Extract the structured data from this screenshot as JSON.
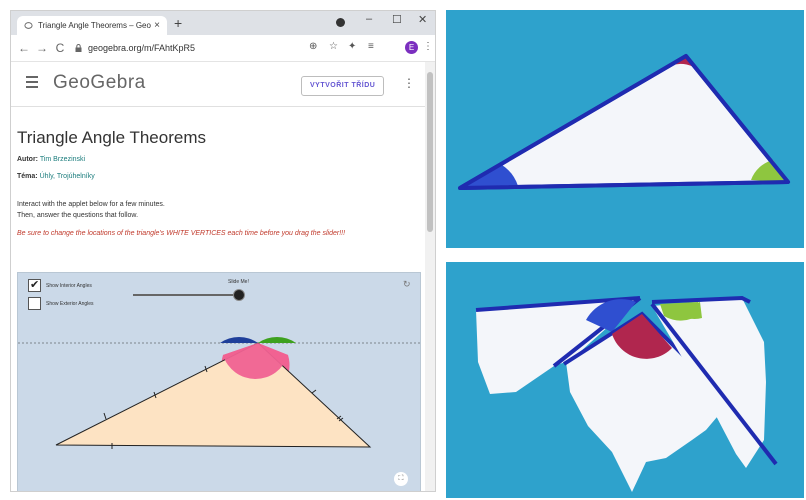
{
  "browser": {
    "tab_title": "Triangle Angle Theorems – GeoG",
    "tab_close": "×",
    "new_tab": "+",
    "window_controls": {
      "minimize": "–",
      "maximize": "☐",
      "close": "✕"
    },
    "nav": {
      "back": "←",
      "forward": "→",
      "reload": "C"
    },
    "url": "geogebra.org/m/FAhtKpR5",
    "toolbar_icons": {
      "zoom": "⊕",
      "star": "☆",
      "extensions": "✦",
      "reading_list": "≡",
      "menu": "⋮"
    },
    "profile_initial": "E"
  },
  "geogebra": {
    "logo": "GeoGebra",
    "create_class_button": "VYTVOŘIT TŘÍDU",
    "menu_dots": "⋮"
  },
  "material": {
    "title": "Triangle Angle Theorems",
    "author_label": "Autor:",
    "author": "Tim Brzezinski",
    "topic_label": "Téma:",
    "topics": "Úhly, Trojúhelníky",
    "intro_line1": "Interact with the applet below for a few minutes.",
    "intro_line2": "Then, answer the questions that follow.",
    "warning": "Be sure to change the locations of the triangle's WHITE VERTICES each time before you drag the slider!!!"
  },
  "applet": {
    "checkbox1_label": "Show Interior Angles",
    "checkbox1_checked": true,
    "checkbox1_mark": "✔",
    "checkbox2_label": "Show Exterior Angles",
    "checkbox2_checked": false,
    "slider_label": "Slide Me!",
    "reset_icon": "↻",
    "fullscreen_icon": "⛶",
    "colors": {
      "triangle_fill": "#fde3c3",
      "angle_pink": "#f06292",
      "angle_blue": "#1f3f9a",
      "angle_green": "#3da11e",
      "background": "#cbd9e8"
    }
  },
  "photos": {
    "background_color": "#2ea2cc",
    "outline_color": "#1f2bb0",
    "angle_red": "#b0264e",
    "angle_blue": "#2f4fd0",
    "angle_green": "#8ec63f"
  }
}
